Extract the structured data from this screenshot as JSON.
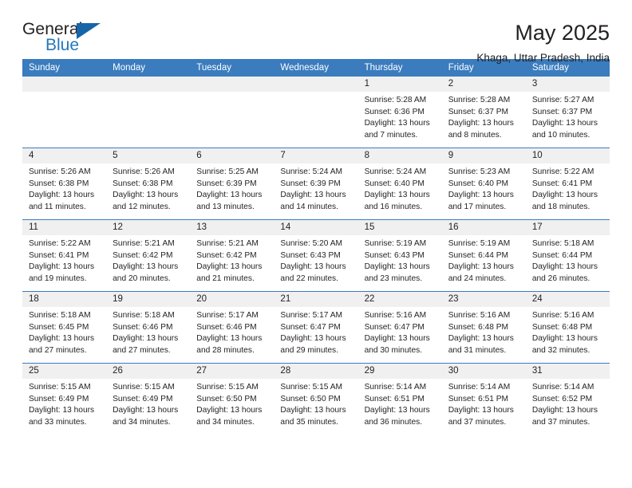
{
  "brand": {
    "logo_top": "General",
    "logo_bottom": "Blue",
    "accent_color": "#2277bb",
    "triangle_color": "#1565a8"
  },
  "header": {
    "title": "May 2025",
    "subtitle": "Khaga, Uttar Pradesh, India"
  },
  "calendar": {
    "header_bg": "#3a7cbe",
    "daynum_bg": "#f0f0f0",
    "weekdays": [
      "Sunday",
      "Monday",
      "Tuesday",
      "Wednesday",
      "Thursday",
      "Friday",
      "Saturday"
    ],
    "weeks": [
      [
        {
          "day": "",
          "sunrise": "",
          "sunset": "",
          "daylight1": "",
          "daylight2": "",
          "empty": true
        },
        {
          "day": "",
          "sunrise": "",
          "sunset": "",
          "daylight1": "",
          "daylight2": "",
          "empty": true
        },
        {
          "day": "",
          "sunrise": "",
          "sunset": "",
          "daylight1": "",
          "daylight2": "",
          "empty": true
        },
        {
          "day": "",
          "sunrise": "",
          "sunset": "",
          "daylight1": "",
          "daylight2": "",
          "empty": true
        },
        {
          "day": "1",
          "sunrise": "Sunrise: 5:28 AM",
          "sunset": "Sunset: 6:36 PM",
          "daylight1": "Daylight: 13 hours",
          "daylight2": "and 7 minutes."
        },
        {
          "day": "2",
          "sunrise": "Sunrise: 5:28 AM",
          "sunset": "Sunset: 6:37 PM",
          "daylight1": "Daylight: 13 hours",
          "daylight2": "and 8 minutes."
        },
        {
          "day": "3",
          "sunrise": "Sunrise: 5:27 AM",
          "sunset": "Sunset: 6:37 PM",
          "daylight1": "Daylight: 13 hours",
          "daylight2": "and 10 minutes."
        }
      ],
      [
        {
          "day": "4",
          "sunrise": "Sunrise: 5:26 AM",
          "sunset": "Sunset: 6:38 PM",
          "daylight1": "Daylight: 13 hours",
          "daylight2": "and 11 minutes."
        },
        {
          "day": "5",
          "sunrise": "Sunrise: 5:26 AM",
          "sunset": "Sunset: 6:38 PM",
          "daylight1": "Daylight: 13 hours",
          "daylight2": "and 12 minutes."
        },
        {
          "day": "6",
          "sunrise": "Sunrise: 5:25 AM",
          "sunset": "Sunset: 6:39 PM",
          "daylight1": "Daylight: 13 hours",
          "daylight2": "and 13 minutes."
        },
        {
          "day": "7",
          "sunrise": "Sunrise: 5:24 AM",
          "sunset": "Sunset: 6:39 PM",
          "daylight1": "Daylight: 13 hours",
          "daylight2": "and 14 minutes."
        },
        {
          "day": "8",
          "sunrise": "Sunrise: 5:24 AM",
          "sunset": "Sunset: 6:40 PM",
          "daylight1": "Daylight: 13 hours",
          "daylight2": "and 16 minutes."
        },
        {
          "day": "9",
          "sunrise": "Sunrise: 5:23 AM",
          "sunset": "Sunset: 6:40 PM",
          "daylight1": "Daylight: 13 hours",
          "daylight2": "and 17 minutes."
        },
        {
          "day": "10",
          "sunrise": "Sunrise: 5:22 AM",
          "sunset": "Sunset: 6:41 PM",
          "daylight1": "Daylight: 13 hours",
          "daylight2": "and 18 minutes."
        }
      ],
      [
        {
          "day": "11",
          "sunrise": "Sunrise: 5:22 AM",
          "sunset": "Sunset: 6:41 PM",
          "daylight1": "Daylight: 13 hours",
          "daylight2": "and 19 minutes."
        },
        {
          "day": "12",
          "sunrise": "Sunrise: 5:21 AM",
          "sunset": "Sunset: 6:42 PM",
          "daylight1": "Daylight: 13 hours",
          "daylight2": "and 20 minutes."
        },
        {
          "day": "13",
          "sunrise": "Sunrise: 5:21 AM",
          "sunset": "Sunset: 6:42 PM",
          "daylight1": "Daylight: 13 hours",
          "daylight2": "and 21 minutes."
        },
        {
          "day": "14",
          "sunrise": "Sunrise: 5:20 AM",
          "sunset": "Sunset: 6:43 PM",
          "daylight1": "Daylight: 13 hours",
          "daylight2": "and 22 minutes."
        },
        {
          "day": "15",
          "sunrise": "Sunrise: 5:19 AM",
          "sunset": "Sunset: 6:43 PM",
          "daylight1": "Daylight: 13 hours",
          "daylight2": "and 23 minutes."
        },
        {
          "day": "16",
          "sunrise": "Sunrise: 5:19 AM",
          "sunset": "Sunset: 6:44 PM",
          "daylight1": "Daylight: 13 hours",
          "daylight2": "and 24 minutes."
        },
        {
          "day": "17",
          "sunrise": "Sunrise: 5:18 AM",
          "sunset": "Sunset: 6:44 PM",
          "daylight1": "Daylight: 13 hours",
          "daylight2": "and 26 minutes."
        }
      ],
      [
        {
          "day": "18",
          "sunrise": "Sunrise: 5:18 AM",
          "sunset": "Sunset: 6:45 PM",
          "daylight1": "Daylight: 13 hours",
          "daylight2": "and 27 minutes."
        },
        {
          "day": "19",
          "sunrise": "Sunrise: 5:18 AM",
          "sunset": "Sunset: 6:46 PM",
          "daylight1": "Daylight: 13 hours",
          "daylight2": "and 27 minutes."
        },
        {
          "day": "20",
          "sunrise": "Sunrise: 5:17 AM",
          "sunset": "Sunset: 6:46 PM",
          "daylight1": "Daylight: 13 hours",
          "daylight2": "and 28 minutes."
        },
        {
          "day": "21",
          "sunrise": "Sunrise: 5:17 AM",
          "sunset": "Sunset: 6:47 PM",
          "daylight1": "Daylight: 13 hours",
          "daylight2": "and 29 minutes."
        },
        {
          "day": "22",
          "sunrise": "Sunrise: 5:16 AM",
          "sunset": "Sunset: 6:47 PM",
          "daylight1": "Daylight: 13 hours",
          "daylight2": "and 30 minutes."
        },
        {
          "day": "23",
          "sunrise": "Sunrise: 5:16 AM",
          "sunset": "Sunset: 6:48 PM",
          "daylight1": "Daylight: 13 hours",
          "daylight2": "and 31 minutes."
        },
        {
          "day": "24",
          "sunrise": "Sunrise: 5:16 AM",
          "sunset": "Sunset: 6:48 PM",
          "daylight1": "Daylight: 13 hours",
          "daylight2": "and 32 minutes."
        }
      ],
      [
        {
          "day": "25",
          "sunrise": "Sunrise: 5:15 AM",
          "sunset": "Sunset: 6:49 PM",
          "daylight1": "Daylight: 13 hours",
          "daylight2": "and 33 minutes."
        },
        {
          "day": "26",
          "sunrise": "Sunrise: 5:15 AM",
          "sunset": "Sunset: 6:49 PM",
          "daylight1": "Daylight: 13 hours",
          "daylight2": "and 34 minutes."
        },
        {
          "day": "27",
          "sunrise": "Sunrise: 5:15 AM",
          "sunset": "Sunset: 6:50 PM",
          "daylight1": "Daylight: 13 hours",
          "daylight2": "and 34 minutes."
        },
        {
          "day": "28",
          "sunrise": "Sunrise: 5:15 AM",
          "sunset": "Sunset: 6:50 PM",
          "daylight1": "Daylight: 13 hours",
          "daylight2": "and 35 minutes."
        },
        {
          "day": "29",
          "sunrise": "Sunrise: 5:14 AM",
          "sunset": "Sunset: 6:51 PM",
          "daylight1": "Daylight: 13 hours",
          "daylight2": "and 36 minutes."
        },
        {
          "day": "30",
          "sunrise": "Sunrise: 5:14 AM",
          "sunset": "Sunset: 6:51 PM",
          "daylight1": "Daylight: 13 hours",
          "daylight2": "and 37 minutes."
        },
        {
          "day": "31",
          "sunrise": "Sunrise: 5:14 AM",
          "sunset": "Sunset: 6:52 PM",
          "daylight1": "Daylight: 13 hours",
          "daylight2": "and 37 minutes."
        }
      ]
    ]
  }
}
